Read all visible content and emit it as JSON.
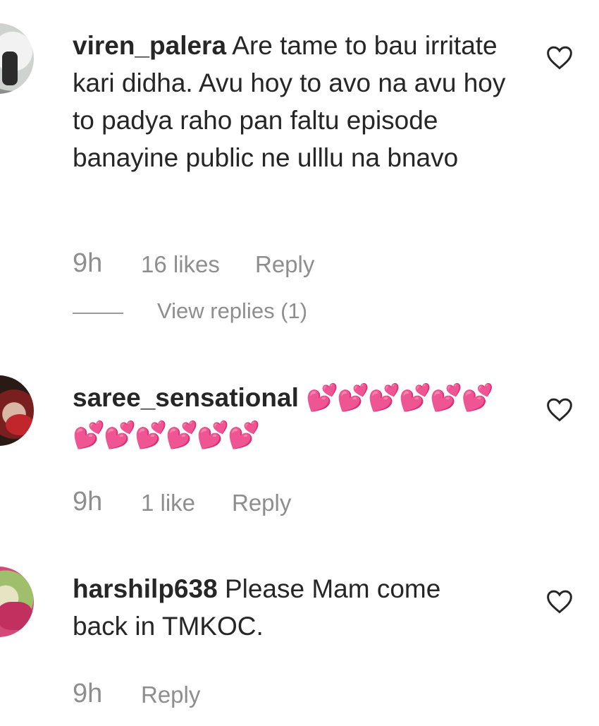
{
  "comments": [
    {
      "username": "viren_palera",
      "text": "Are tame to bau irritate kari didha. Avu hoy to avo na avu hoy to padya raho pan faltu episode banayine public ne ulllu na bnavo",
      "time": "9h",
      "likes": "16 likes",
      "reply": "Reply",
      "view_replies": "View replies (1)",
      "like_icon": "heart-outline-icon"
    },
    {
      "username": "saree_sensational",
      "text_line1": "💕💕💕💕💕💕",
      "text_line2": "💕💕💕💕💕💕",
      "time": "9h",
      "likes": "1 like",
      "reply": "Reply",
      "like_icon": "heart-outline-icon"
    },
    {
      "username": "harshilp638",
      "text": "Please Mam come back in TMKOC.",
      "time": "9h",
      "reply": "Reply",
      "like_icon": "heart-outline-icon"
    }
  ],
  "colors": {
    "text": "#262626",
    "meta": "#8e8e8e",
    "heart_emoji": "#c8161d"
  }
}
